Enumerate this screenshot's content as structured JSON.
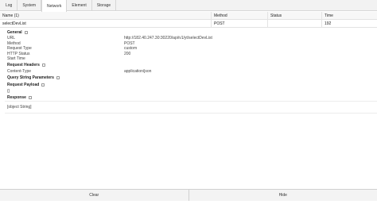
{
  "tabs": [
    {
      "label": "Log"
    },
    {
      "label": "System"
    },
    {
      "label": "Network"
    },
    {
      "label": "Element"
    },
    {
      "label": "Storage"
    }
  ],
  "table": {
    "headers": {
      "name": "Name (1)",
      "method": "Method",
      "status": "Status",
      "time": "Time"
    },
    "rows": [
      {
        "name": "selectDevList",
        "method": "POST",
        "status": "",
        "time": "192"
      }
    ]
  },
  "details": {
    "general": {
      "title": "General",
      "fields": [
        {
          "key": "URL",
          "value": "http://182.40.247.30:30220/api/v1/yt/selectDevList"
        },
        {
          "key": "Method",
          "value": "POST"
        },
        {
          "key": "Request Type",
          "value": "custom"
        },
        {
          "key": "HTTP Status",
          "value": "200"
        },
        {
          "key": "Start Time",
          "value": ""
        }
      ]
    },
    "request_headers": {
      "title": "Request Headers",
      "fields": [
        {
          "key": "Content-Type",
          "value": "application/json"
        }
      ]
    },
    "query_params": {
      "title": "Query String Parameters"
    },
    "request_payload": {
      "title": "Request Payload",
      "body": "{}"
    },
    "response": {
      "title": "Response",
      "body": "[object String]"
    }
  },
  "bottom": {
    "clear_label": "Clear",
    "hide_label": "Hide"
  }
}
